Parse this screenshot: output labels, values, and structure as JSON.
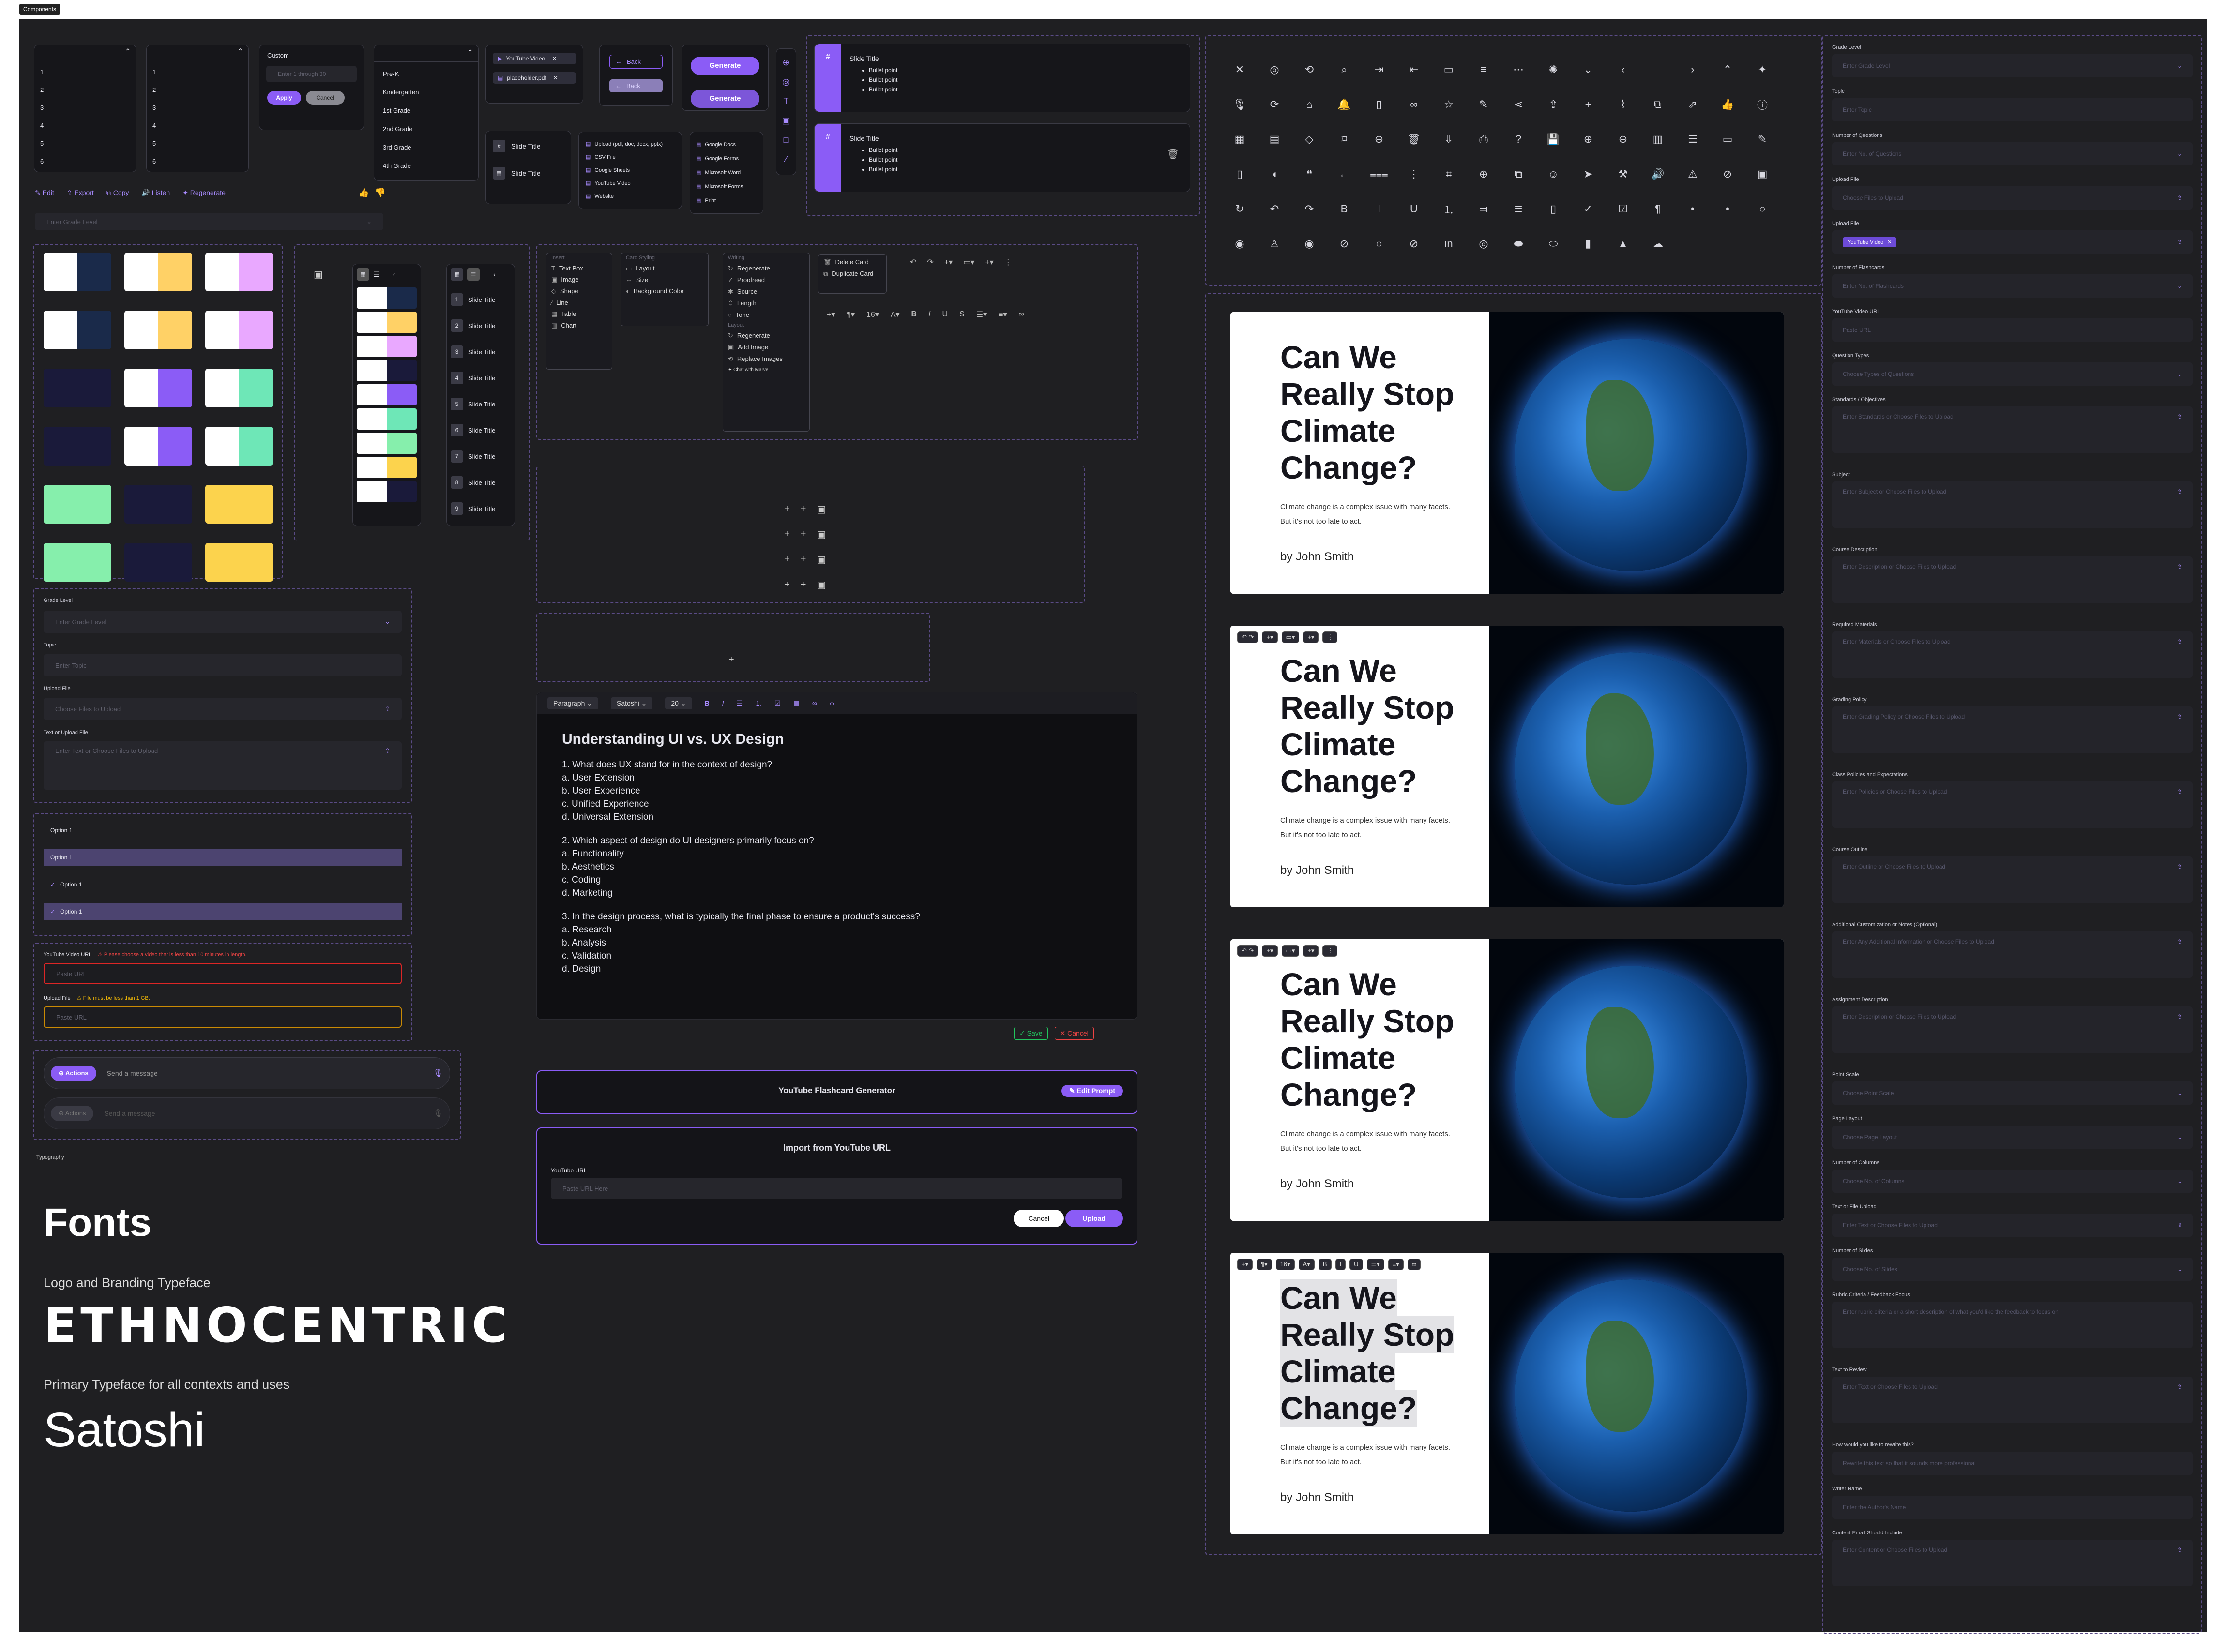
{
  "frame_tag": "Components",
  "top_left": {
    "dropdown1": [
      "1",
      "2",
      "3",
      "4",
      "5",
      "6"
    ],
    "dropdown2": [
      "1",
      "2",
      "3",
      "4",
      "5",
      "6"
    ],
    "custom_title": "Custom",
    "custom_placeholder": "Enter 1 through 30",
    "apply": "Apply",
    "cancel": "Cancel",
    "grades": [
      "Pre-K",
      "Kindergarten",
      "1st Grade",
      "2nd Grade",
      "3rd Grade",
      "4th Grade"
    ],
    "actions": [
      "Edit",
      "Export",
      "Copy",
      "Listen",
      "Regenerate"
    ],
    "grade_placeholder": "Enter Grade Level"
  },
  "chips": {
    "youtube": "YouTube Video",
    "pdf": "placeholder.pdf",
    "back": "Back",
    "generate": "Generate",
    "slide_title": "Slide Title",
    "upload_list": [
      "Upload (pdf, doc, docx, pptx)",
      "CSV File",
      "Google Sheets",
      "YouTube Video",
      "Website"
    ],
    "export_list": [
      "Google Docs",
      "Google Forms",
      "Microsoft Word",
      "Microsoft Forms",
      "Print"
    ]
  },
  "slide_cards": {
    "title": "Slide Title",
    "bullets": [
      "Bullet point",
      "Bullet point",
      "Bullet point"
    ]
  },
  "menus": {
    "insert_title": "Insert",
    "insert": [
      "Text Box",
      "Image",
      "Shape",
      "Line",
      "Table",
      "Chart"
    ],
    "card_styling_title": "Card Styling",
    "card_styling": [
      "Layout",
      "Size",
      "Background Color"
    ],
    "writing_title": "Writing",
    "writing": [
      "Regenerate",
      "Proofread",
      "Source",
      "Length",
      "Tone"
    ],
    "layout_title": "Layout",
    "layout": [
      "Regenerate",
      "Add Image",
      "Replace Images"
    ],
    "chat": "Chat with Marvel",
    "card_actions": [
      "Delete Card",
      "Duplicate Card"
    ]
  },
  "slide_list": [
    "Slide Title",
    "Slide Title",
    "Slide Title",
    "Slide Title",
    "Slide Title",
    "Slide Title",
    "Slide Title",
    "Slide Title",
    "Slide Title"
  ],
  "form_left": {
    "grade_label": "Grade Level",
    "grade_placeholder": "Enter Grade Level",
    "topic_label": "Topic",
    "topic_placeholder": "Enter Topic",
    "upload_label": "Upload File",
    "upload_placeholder": "Choose Files to Upload",
    "text_label": "Text or Upload File",
    "text_placeholder": "Enter Text or Choose Files to Upload"
  },
  "options": [
    "Option 1",
    "Option 1",
    "Option 1",
    "Option 1"
  ],
  "errors": {
    "yt_label": "YouTube Video URL",
    "yt_error": "Please choose a video that is less than 10 minutes in length.",
    "yt_placeholder": "Paste URL",
    "file_label": "Upload File",
    "file_error": "File must be less than 1 GB.",
    "file_placeholder": "Paste URL"
  },
  "chat": {
    "actions": "Actions",
    "placeholder": "Send a message"
  },
  "typography": {
    "tag": "Typography",
    "heading": "Fonts",
    "logo_caption": "Logo and Branding Typeface",
    "logo_font": "ETHNOCENTRIC",
    "primary_caption": "Primary Typeface for all contexts and uses",
    "primary_font": "Satoshi"
  },
  "editor": {
    "paragraph": "Paragraph",
    "font": "Satoshi",
    "size": "20",
    "title": "Understanding UI vs. UX Design",
    "lines": [
      "1. What does UX stand for in the context of design?",
      "a. User Extension",
      "b. User Experience",
      "c. Unified Experience",
      "d. Universal Extension",
      "",
      "2. Which aspect of design do UI designers primarily focus on?",
      "a. Functionality",
      "b. Aesthetics",
      "c. Coding",
      "d. Marketing",
      "",
      "3. In the design process, what is typically the final phase to ensure a product's success?",
      "a. Research",
      "b. Analysis",
      "c. Validation",
      "d. Design"
    ],
    "save": "Save",
    "cancel": "Cancel"
  },
  "yt_gen": {
    "title": "YouTube Flashcard Generator",
    "edit": "Edit Prompt"
  },
  "import_dialog": {
    "title": "Import from YouTube  URL",
    "label": "YouTube URL",
    "placeholder": "Paste URL Here",
    "cancel": "Cancel",
    "upload": "Upload"
  },
  "icons": [
    [
      "close-icon",
      "✕"
    ],
    [
      "target-icon",
      "◎"
    ],
    [
      "history-icon",
      "⟲"
    ],
    [
      "search-icon",
      "⌕"
    ],
    [
      "login-icon",
      "⇥"
    ],
    [
      "logout-icon",
      "⇤"
    ],
    [
      "panel-icon",
      "▭"
    ],
    [
      "menu-icon",
      "≡"
    ],
    [
      "more-icon",
      "⋯"
    ],
    [
      "loader-icon",
      "✺"
    ],
    [
      "chevron-down-icon",
      "⌄"
    ],
    [
      "chevron-left-icon",
      "‹"
    ],
    [
      "blank-icon",
      " "
    ],
    [
      "chevron-right-icon",
      "›"
    ],
    [
      "chevron-up-icon",
      "⌃"
    ],
    [
      "sparkle-icon",
      "✦"
    ],
    [
      "mic-icon",
      "🎙"
    ],
    [
      "repeat-icon",
      "⟳"
    ],
    [
      "home-icon",
      "⌂"
    ],
    [
      "bell-icon",
      "🔔"
    ],
    [
      "tablet-icon",
      "▯"
    ],
    [
      "link-icon",
      "∞"
    ],
    [
      "star-icon",
      "☆"
    ],
    [
      "pen-icon",
      "✎"
    ],
    [
      "share-icon",
      "⋖"
    ],
    [
      "upload-icon",
      "⇪"
    ],
    [
      "plus-icon",
      "+"
    ],
    [
      "paperclip-icon",
      "⌇"
    ],
    [
      "copy-icon",
      "⧉"
    ],
    [
      "external-icon",
      "⇗"
    ],
    [
      "thumbs-up-icon",
      "👍"
    ],
    [
      "info-icon",
      "ⓘ"
    ],
    [
      "calendar-icon",
      "▦"
    ],
    [
      "card-icon",
      "▤"
    ],
    [
      "layers-icon",
      "◇"
    ],
    [
      "bookmark-icon",
      "⌑"
    ],
    [
      "minus-circle-icon",
      "⊖"
    ],
    [
      "trash-icon",
      "🗑"
    ],
    [
      "download-icon",
      "⇩"
    ],
    [
      "print-icon",
      "⎙"
    ],
    [
      "help-icon",
      "?"
    ],
    [
      "save-icon",
      "💾"
    ],
    [
      "zoom-in-icon",
      "⊕"
    ],
    [
      "zoom-out-icon",
      "⊖"
    ],
    [
      "presentation-icon",
      "▥"
    ],
    [
      "list-icon",
      "☰"
    ],
    [
      "folder-icon",
      "▭"
    ],
    [
      "edit-icon",
      "✎"
    ],
    [
      "file-icon",
      "▯"
    ],
    [
      "chat-icon",
      "◖"
    ],
    [
      "quote-icon",
      "❝"
    ],
    [
      "arrow-left-icon",
      "←"
    ],
    [
      "sliders-icon",
      "⩶"
    ],
    [
      "kebab-icon",
      "⋮"
    ],
    [
      "tag-icon",
      "⌗"
    ],
    [
      "add-circle-icon",
      "⊕"
    ],
    [
      "duplicate-icon",
      "⧉"
    ],
    [
      "smile-icon",
      "☺"
    ],
    [
      "send-icon",
      "➤"
    ],
    [
      "wand-icon",
      "⚒"
    ],
    [
      "volume-icon",
      "🔊"
    ],
    [
      "warning-icon",
      "⚠"
    ],
    [
      "check-circle-icon",
      "⊘"
    ],
    [
      "image-icon",
      "▣"
    ],
    [
      "refresh-icon",
      "↻"
    ],
    [
      "undo-icon",
      "↶"
    ],
    [
      "redo-icon",
      "↷"
    ],
    [
      "bold-icon",
      "B"
    ],
    [
      "italic-icon",
      "I"
    ],
    [
      "underline-icon",
      "U"
    ],
    [
      "ordered-list-icon",
      "⒈"
    ],
    [
      "align-right-icon",
      "⫤"
    ],
    [
      "align-justify-icon",
      "≣"
    ],
    [
      "note-icon",
      "▯"
    ],
    [
      "checkmark-icon",
      "✓"
    ],
    [
      "checkbox-icon",
      "☑"
    ],
    [
      "text-format-icon",
      "¶"
    ],
    [
      "dot-small-icon",
      "•"
    ],
    [
      "dot-icon",
      "•"
    ],
    [
      "radio-empty-icon",
      "○"
    ],
    [
      "radio-filled-icon",
      "◉"
    ],
    [
      "user-icon",
      "♙"
    ],
    [
      "eye-icon",
      "◉"
    ],
    [
      "eye-off-icon",
      "⊘"
    ],
    [
      "circle-icon",
      "○"
    ],
    [
      "check-round-icon",
      "⊘"
    ],
    [
      "linkedin-icon",
      "in"
    ],
    [
      "instagram-icon",
      "◎"
    ],
    [
      "toggle-on-icon",
      "⬬"
    ],
    [
      "toggle-off-icon",
      "⬭"
    ],
    [
      "book-icon",
      "▮"
    ],
    [
      "google-drive-icon",
      "▲"
    ],
    [
      "onedrive-icon",
      "☁"
    ]
  ],
  "slide_preview": {
    "title_lines": [
      "Can We",
      "Really Stop",
      "Climate",
      "Change?"
    ],
    "subtitle": "Climate change is a complex issue with many facets. But it's not too late to act.",
    "author": "by John Smith"
  },
  "right_form": [
    {
      "label": "Grade Level",
      "placeholder": "Enter Grade Level",
      "icon": "chevron-down-icon"
    },
    {
      "label": "Topic",
      "placeholder": "Enter Topic",
      "icon": ""
    },
    {
      "label": "Number of Questions",
      "placeholder": "Enter No. of Questions",
      "icon": "chevron-down-icon"
    },
    {
      "label": "Upload File",
      "placeholder": "Choose Files to Upload",
      "icon": "upload-icon"
    },
    {
      "label": "Upload File",
      "placeholder": "YouTube Video",
      "icon": "upload-icon"
    },
    {
      "label": "Number of Flashcards",
      "placeholder": "Enter No. of Flashcards",
      "icon": "chevron-down-icon"
    },
    {
      "label": "YouTube Video URL",
      "placeholder": "Paste URL",
      "icon": ""
    },
    {
      "label": "Question Types",
      "placeholder": "Choose Types of Questions",
      "icon": "chevron-down-icon"
    },
    {
      "label": "Standards / Objectives",
      "placeholder": "Enter Standards or Choose Files to Upload",
      "icon": "upload-icon"
    },
    {
      "label": "Subject",
      "placeholder": "Enter Subject or Choose Files to Upload",
      "icon": "upload-icon"
    },
    {
      "label": "Course Description",
      "placeholder": "Enter Description or Choose Files to Upload",
      "icon": "upload-icon"
    },
    {
      "label": "Required Materials",
      "placeholder": "Enter Materials or Choose Files to Upload",
      "icon": "upload-icon"
    },
    {
      "label": "Grading Policy",
      "placeholder": "Enter Grading Policy or Choose Files to Upload",
      "icon": "upload-icon"
    },
    {
      "label": "Class Policies and Expectations",
      "placeholder": "Enter Policies or Choose Files to Upload",
      "icon": "upload-icon"
    },
    {
      "label": "Course Outline",
      "placeholder": "Enter Outline or Choose Files to Upload",
      "icon": "upload-icon"
    },
    {
      "label": "Additional Customization or Notes (Optional)",
      "placeholder": "Enter Any Additional Information or Choose Files to Upload",
      "icon": "upload-icon"
    },
    {
      "label": "Assignment Description",
      "placeholder": "Enter Description or Choose Files to Upload",
      "icon": "upload-icon"
    },
    {
      "label": "Point Scale",
      "placeholder": "Choose Point Scale",
      "icon": "chevron-down-icon"
    },
    {
      "label": "Page Layout",
      "placeholder": "Choose Page Layout",
      "icon": "chevron-down-icon"
    },
    {
      "label": "Number of Columns",
      "placeholder": "Choose No. of Columns",
      "icon": "chevron-down-icon"
    },
    {
      "label": "Text or File Upload",
      "placeholder": "Enter Text or Choose Files to Upload",
      "icon": "upload-icon"
    },
    {
      "label": "Number of Slides",
      "placeholder": "Choose No. of Slides",
      "icon": "chevron-down-icon"
    },
    {
      "label": "Rubric Criteria / Feedback Focus",
      "placeholder": "Enter rubric criteria or a short description of what you'd like the feedback to focus on",
      "icon": ""
    },
    {
      "label": "Text to Review",
      "placeholder": "Enter Text or Choose Files to Upload",
      "icon": "upload-icon"
    },
    {
      "label": "How would you like to rewrite this?",
      "placeholder": "Rewrite this text so that it sounds more professional",
      "icon": ""
    },
    {
      "label": "Writer Name",
      "placeholder": "Enter the Author's Name",
      "icon": ""
    },
    {
      "label": "Content Email Should Include",
      "placeholder": "Enter Content or Choose Files to Upload",
      "icon": "upload-icon"
    }
  ]
}
